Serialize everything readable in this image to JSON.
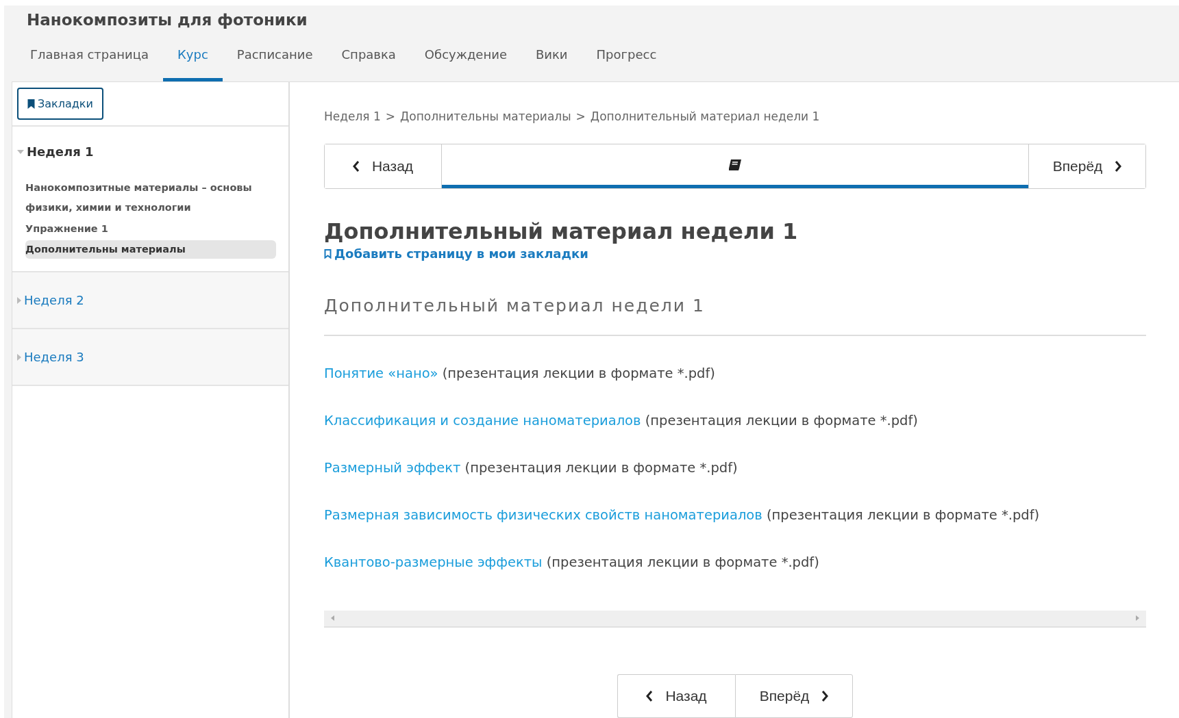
{
  "course_title": "Нанокомпозиты для фотоники",
  "tabs": [
    {
      "label": "Главная страница",
      "selected": false
    },
    {
      "label": "Курс",
      "selected": true
    },
    {
      "label": "Расписание",
      "selected": false
    },
    {
      "label": "Справка",
      "selected": false
    },
    {
      "label": "Обсуждение",
      "selected": false
    },
    {
      "label": "Вики",
      "selected": false
    },
    {
      "label": "Прогресс",
      "selected": false
    }
  ],
  "sidebar": {
    "bookmarks_button": "Закладки",
    "sections": [
      {
        "title": "Неделя 1",
        "expanded": true,
        "items": [
          {
            "label": "Нанокомпозитные материалы – основы физики, химии и технологии",
            "selected": false
          },
          {
            "label": "Упражнение 1",
            "selected": false
          },
          {
            "label": "Дополнительны материалы",
            "selected": true
          }
        ]
      },
      {
        "title": "Неделя 2",
        "expanded": false
      },
      {
        "title": "Неделя 3",
        "expanded": false
      }
    ]
  },
  "breadcrumb": {
    "separator": ">",
    "items": [
      "Неделя 1",
      "Дополнительны материалы",
      "Дополнительный материал недели 1"
    ]
  },
  "sequence_nav": {
    "prev": "Назад",
    "next": "Вперёд",
    "units": [
      {
        "kind": "text",
        "selected": true
      }
    ]
  },
  "page_title": "Дополнительный материал недели 1",
  "bookmark_link": "Добавить страницу в мои закладки",
  "section_heading": "Дополнительный материал недели 1",
  "resources": [
    {
      "link": "Понятие «нано»",
      "note": "(презентация лекции в формате *.pdf)"
    },
    {
      "link": "Классификация и создание наноматериалов",
      "note": "(презентация лекции в формате *.pdf)"
    },
    {
      "link": "Размерный эффект",
      "note": "(презентация лекции в формате *.pdf)"
    },
    {
      "link": "Размерная зависимость физических свойств наноматериалов",
      "note": "(презентация лекции в формате *.pdf)"
    },
    {
      "link": "Квантово-размерные эффекты",
      "note": "(презентация лекции в формате *.pdf)"
    }
  ],
  "bottom_nav": {
    "prev": "Назад",
    "next": "Вперёд"
  }
}
